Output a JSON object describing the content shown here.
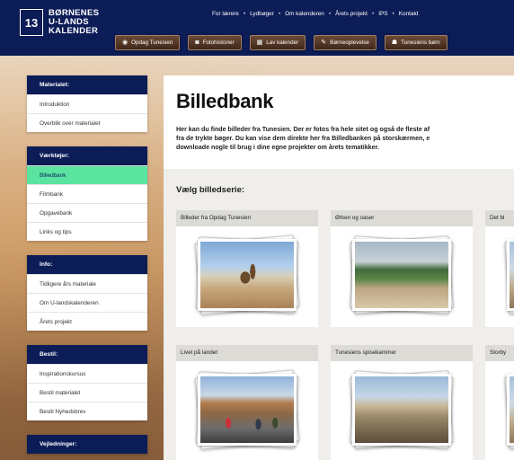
{
  "logo": {
    "mark": "13",
    "line1": "BØRNENES",
    "line2": "U-LANDS",
    "line3": "KALENDER"
  },
  "topnav": {
    "items": [
      "For lærere",
      "Lydbøger",
      "Om kalenderen",
      "Årets projekt",
      "IPS",
      "Kontakt"
    ],
    "separator": "•"
  },
  "themes": [
    {
      "label": "Opdag Tunesien",
      "icon": "eye-icon",
      "glyph": "◉"
    },
    {
      "label": "Fotohistorier",
      "icon": "camera-icon",
      "glyph": "◙"
    },
    {
      "label": "Lav kalender",
      "icon": "grid-icon",
      "glyph": "▦"
    },
    {
      "label": "Børneoplevelse",
      "icon": "pencil-icon",
      "glyph": "✎"
    },
    {
      "label": "Tunesiens børn",
      "icon": "people-icon",
      "glyph": "☗"
    }
  ],
  "sidebar": {
    "groups": [
      {
        "title": "Materialet:",
        "items": [
          "Introduktion",
          "Overblik over materialet"
        ]
      },
      {
        "title": "Værktøjer:",
        "items": [
          "Billedbank",
          "Filmbank",
          "Opgavebank",
          "Links og tips"
        ]
      },
      {
        "title": "Info:",
        "items": [
          "Tidligere års materiale",
          "Om U-landskalenderen",
          "Årets projekt"
        ]
      },
      {
        "title": "Bestil:",
        "items": [
          "Inspirationskursus",
          "Bestil materialet",
          "Bestil Nyhedsbrev"
        ]
      },
      {
        "title": "Vejledninger:",
        "items": []
      }
    ],
    "active": "Billedbank"
  },
  "main": {
    "title": "Billedbank",
    "intro": "Her kan du finde billeder fra Tunesien. Der er fotos fra hele sitet og også de fleste af\nfra de trykte bøger. Du kan vise dem direkte her fra Billedbanken på storskærmen, e\ndownloade nogle til brug i dine egne projekter om årets tematikker.",
    "choose": "Vælg billedserie:",
    "cards": [
      {
        "caption": "Billeder fra Opdag Tunesien"
      },
      {
        "caption": "Ørken og oaser"
      },
      {
        "caption": "Det bl"
      },
      {
        "caption": "Livet på landet"
      },
      {
        "caption": "Tunesiens spisekammer"
      },
      {
        "caption": "Storby"
      }
    ]
  }
}
